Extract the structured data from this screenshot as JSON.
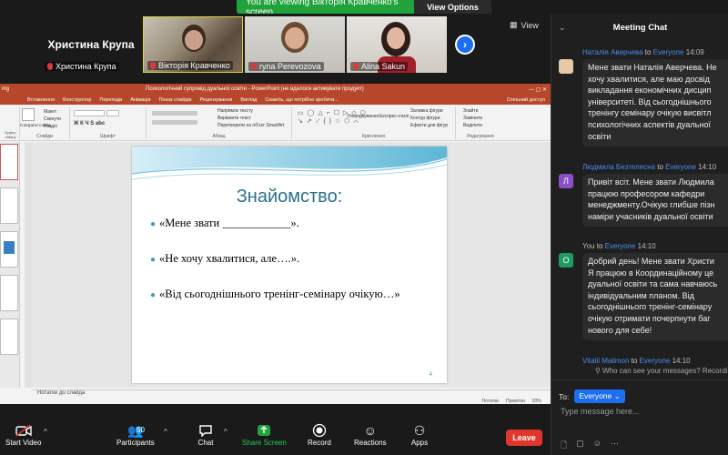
{
  "banner": {
    "text": "You are viewing Вікторія Кравченко's screen",
    "view_options": "View Options"
  },
  "video_strip": {
    "tiles": [
      {
        "big_name": "Христина Крупа",
        "label": "Христина Крупа"
      },
      {
        "label": "Вікторія Кравченко"
      },
      {
        "label": "ryna Perevozova"
      },
      {
        "label": "Alina Sakun"
      }
    ],
    "view_label": "View"
  },
  "ppt": {
    "title": "Психологічний супровід дуальної освіти - PowerPoint (не вдалося активувати продукт)",
    "app_corner": "ing",
    "account": "Спільний доступ",
    "tabs": [
      "Файл",
      "Вставлення",
      "Конструктор",
      "Переходи",
      "Анімація",
      "Показ слайдів",
      "Рецензування",
      "Вигляд",
      "Скажіть, що потрібно зробити..."
    ],
    "ribbon": {
      "clipboard": "Буфер обміну",
      "slides": "Слайди",
      "font": "Шрифт",
      "paragraph": "Абзац",
      "drawing": "Креслення",
      "editing": "Редагування",
      "new_slide": "Створити слайд",
      "layout": "Макет",
      "reset": "Скинути",
      "section": "Розділ",
      "text_direction": "Напрямок тексту",
      "align_text": "Вирівнити текст",
      "smartart": "Перетворити на об'єкт SmartArt",
      "arrange": "Упорядкування",
      "quick_styles": "Експрес-стилі",
      "shape_fill": "Заливка фігури",
      "shape_outline": "Контур фігури",
      "shape_effects": "Ефекти для фігур",
      "find": "Знайти",
      "replace": "Замінити",
      "select": "Виділити"
    },
    "notes": "Нотатки до слайда",
    "status": {
      "notes_btn": "Нотатки",
      "comments_btn": "Примітки",
      "zoom": "83%"
    }
  },
  "slide": {
    "title": "Знайомство:",
    "bullets": [
      "«Мене звати ____________».",
      "«Не  хочу хвалитися, але….».",
      "«Від сьогоднішнього тренінг-семінару очікую…»"
    ],
    "number": "4"
  },
  "toolbar": {
    "start_video": "Start Video",
    "participants": "Participants",
    "participants_count": "50",
    "chat": "Chat",
    "share_screen": "Share Screen",
    "record": "Record",
    "reactions": "Reactions",
    "apps": "Apps",
    "leave": "Leave"
  },
  "chat": {
    "title": "Meeting Chat",
    "messages": [
      {
        "sender": "Наталія Аверчева",
        "to": "to",
        "recipient": "Everyone",
        "time": "14:09",
        "avatar": "",
        "avatar_color": "#e7c9a8",
        "text": "Мене звати Наталія Аверчева. Не\nхочу хвалитися, але маю досвід\nвикладання економічних дисцип\nуніверситеті. Від сьогоднішнього\nтренінгу семінару очікую висвітл\nпсихологічних аспектів дуальної\nосвіти"
      },
      {
        "sender": "Людмила Безтелесна",
        "to": "to",
        "recipient": "Everyone",
        "time": "14:10",
        "avatar": "Л",
        "avatar_color": "#8a4fc9",
        "text": "Привіт всіт. Мене звати Людмила\nпрацюю професором кафедри\nменеджменту.Очікую глибше пізн\nнаміри учасників дуальної освіти"
      },
      {
        "sender": "You",
        "to": "to",
        "recipient": "Everyone",
        "time": "14:10",
        "avatar": "О",
        "avatar_color": "#1e9b63",
        "text": "Добрий день! Мене звати Христи\nЯ працюю в Координаційному це\nдуальної освіти та сама навчаюсь\nіндивідуальним планом. Від\nсьогоднішнього тренінг-семінару\nочікую отримати почерпнути баг\nнового для себе!"
      },
      {
        "sender": "Vitalii Malimon",
        "to": "to",
        "recipient": "Everyone",
        "time": "14:10",
        "avatar": "",
        "avatar_color": "#1f1f1f",
        "text": ""
      }
    ],
    "who_can_see": "Who can see your messages? Recordi",
    "to_label": "To:",
    "to_value": "Everyone",
    "input_placeholder": "Type message here..."
  },
  "colors": {
    "accent": "#1c6ef2",
    "leave": "#e0362c",
    "share_green": "#1fa33a",
    "ppt_red": "#b7472a",
    "slide_title": "#2b6f8a"
  }
}
